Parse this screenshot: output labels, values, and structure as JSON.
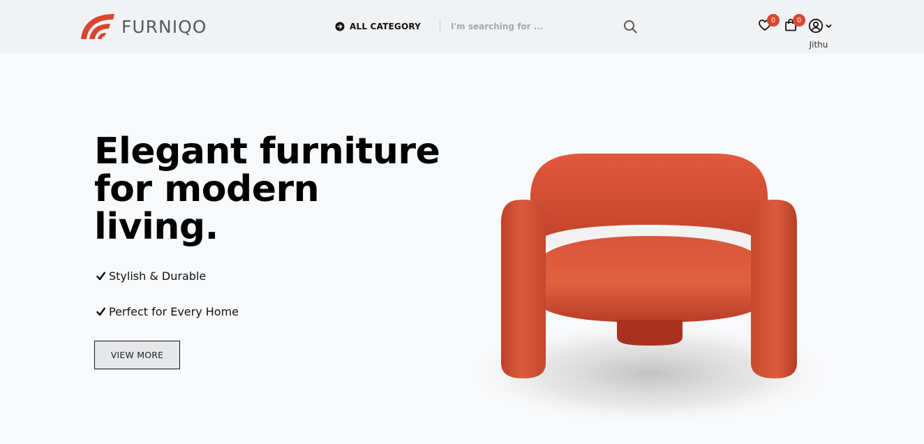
{
  "header": {
    "brand": "FURNIQO",
    "all_category_label": "ALL CATEGORY",
    "search_placeholder": "I'm searching for ...",
    "wishlist_count": "0",
    "cart_count": "0",
    "username": "Jithu"
  },
  "hero": {
    "title_lines": [
      "Elegant furniture",
      "for modern",
      "living."
    ],
    "features": [
      "Stylish & Durable",
      "Perfect for Every Home"
    ],
    "cta_label": "VIEW MORE"
  },
  "icons": {
    "logo": "furniqo-logo-icon",
    "all_category": "arrow-circle-right-icon",
    "search": "search-icon",
    "wishlist": "heart-icon",
    "cart": "shopping-bag-icon",
    "user": "user-circle-icon",
    "dropdown": "chevron-down-icon",
    "check": "check-icon"
  },
  "colors": {
    "accent": "#d9462f",
    "header_bg": "#f1f2f4",
    "page_bg": "#f8f9fa",
    "chair": "#d24a30"
  }
}
